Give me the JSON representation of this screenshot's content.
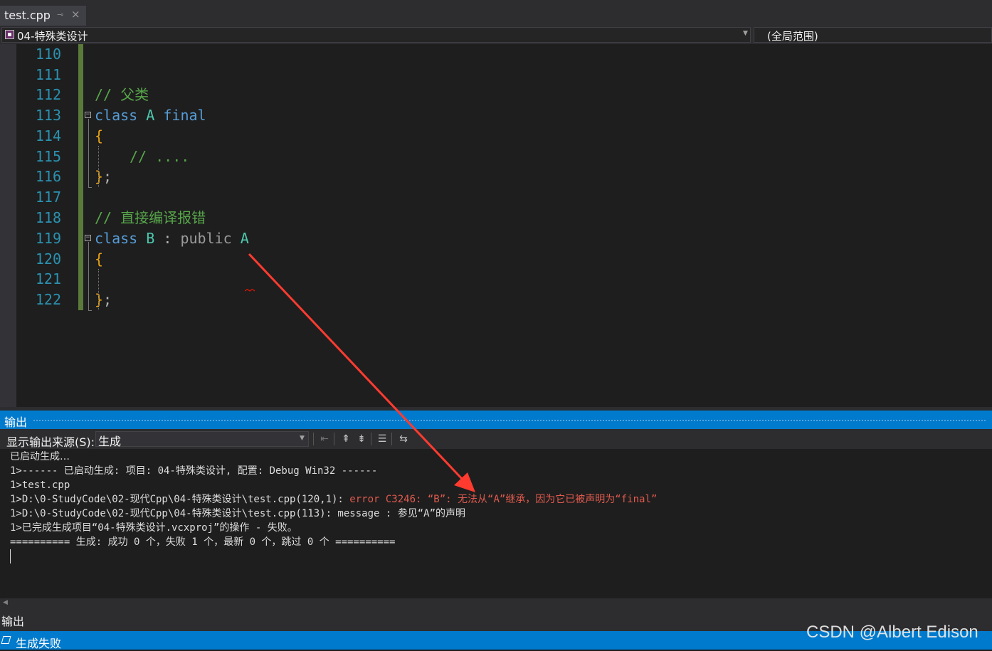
{
  "tab": {
    "label": "test.cpp",
    "pin_glyph": "⊸",
    "close_glyph": "×"
  },
  "nav": {
    "project": "04-特殊类设计",
    "scope": "(全局范围)"
  },
  "editor": {
    "lines": [
      {
        "num": "110",
        "text": ""
      },
      {
        "num": "111",
        "text": ""
      },
      {
        "num": "112",
        "text": "// 父类"
      },
      {
        "num": "113",
        "text": "class A final"
      },
      {
        "num": "114",
        "text": "{"
      },
      {
        "num": "115",
        "text": "// ...."
      },
      {
        "num": "116",
        "text": "};"
      },
      {
        "num": "117",
        "text": ""
      },
      {
        "num": "118",
        "text": "// 直接编译报错"
      },
      {
        "num": "119",
        "text": "class B : public A"
      },
      {
        "num": "120",
        "text": "{"
      },
      {
        "num": "121",
        "text": ""
      },
      {
        "num": "122",
        "text": "};"
      }
    ],
    "tokens": {
      "l112_comment": "// 父类",
      "l113_class": "class",
      "l113_name": "A",
      "l113_final": "final",
      "l114_brace": "{",
      "l115_comment": "// ....",
      "l116_brace": "}",
      "l116_semi": ";",
      "l118_comment": "// 直接编译报错",
      "l119_class": "class",
      "l119_name": "B",
      "l119_colon": ":",
      "l119_public": "public",
      "l119_base": "A",
      "l120_brace": "{",
      "l122_brace": "}",
      "l122_semi": ";"
    }
  },
  "output": {
    "title": "输出",
    "source_label": "显示输出来源(S):",
    "source_value": "生成",
    "toolbar_icons": [
      "goto-previous-message-icon",
      "find-previous-icon",
      "find-next-icon",
      "clear-all-icon",
      "toggle-word-wrap-icon"
    ],
    "lines": {
      "l1": "已启动生成…",
      "l2": "1>------ 已启动生成: 项目: 04-特殊类设计, 配置: Debug Win32 ------",
      "l3": "1>test.cpp",
      "l4_prefix": "1>D:\\0-StudyCode\\02-现代Cpp\\04-特殊类设计\\test.cpp(120,1): ",
      "l4_error": "error C3246: “B”: 无法从“A”继承，因为它已被声明为“final”",
      "l5": "1>D:\\0-StudyCode\\02-现代Cpp\\04-特殊类设计\\test.cpp(113): message : 参见“A”的声明",
      "l6": "1>已完成生成项目“04-特殊类设计.vcxproj”的操作 - 失败。",
      "l7": "========== 生成: 成功 0 个，失败 1 个，最新 0 个，跳过 0 个 =========="
    }
  },
  "bottom_tab": "输出",
  "status": {
    "text": "生成失败"
  },
  "watermark": "CSDN @Albert Edison",
  "colors": {
    "accent": "#007acc",
    "error_text": "#e05a4e",
    "annotation_arrow": "#ff3b30",
    "keyword": "#569cd6",
    "type": "#4ec9b0",
    "comment": "#57a64a",
    "line_number": "#2b91af",
    "brace": "#e8a317"
  }
}
